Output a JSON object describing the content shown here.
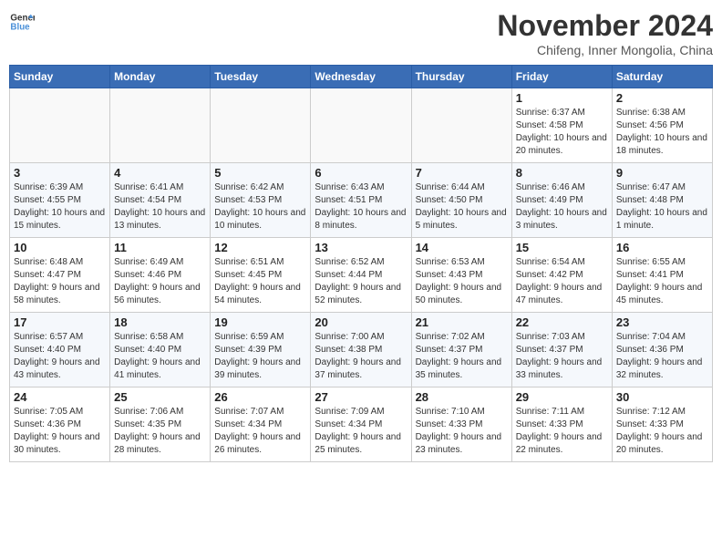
{
  "logo": {
    "line1": "General",
    "line2": "Blue"
  },
  "title": "November 2024",
  "location": "Chifeng, Inner Mongolia, China",
  "days_of_week": [
    "Sunday",
    "Monday",
    "Tuesday",
    "Wednesday",
    "Thursday",
    "Friday",
    "Saturday"
  ],
  "weeks": [
    [
      {
        "num": "",
        "info": ""
      },
      {
        "num": "",
        "info": ""
      },
      {
        "num": "",
        "info": ""
      },
      {
        "num": "",
        "info": ""
      },
      {
        "num": "",
        "info": ""
      },
      {
        "num": "1",
        "info": "Sunrise: 6:37 AM\nSunset: 4:58 PM\nDaylight: 10 hours and 20 minutes."
      },
      {
        "num": "2",
        "info": "Sunrise: 6:38 AM\nSunset: 4:56 PM\nDaylight: 10 hours and 18 minutes."
      }
    ],
    [
      {
        "num": "3",
        "info": "Sunrise: 6:39 AM\nSunset: 4:55 PM\nDaylight: 10 hours and 15 minutes."
      },
      {
        "num": "4",
        "info": "Sunrise: 6:41 AM\nSunset: 4:54 PM\nDaylight: 10 hours and 13 minutes."
      },
      {
        "num": "5",
        "info": "Sunrise: 6:42 AM\nSunset: 4:53 PM\nDaylight: 10 hours and 10 minutes."
      },
      {
        "num": "6",
        "info": "Sunrise: 6:43 AM\nSunset: 4:51 PM\nDaylight: 10 hours and 8 minutes."
      },
      {
        "num": "7",
        "info": "Sunrise: 6:44 AM\nSunset: 4:50 PM\nDaylight: 10 hours and 5 minutes."
      },
      {
        "num": "8",
        "info": "Sunrise: 6:46 AM\nSunset: 4:49 PM\nDaylight: 10 hours and 3 minutes."
      },
      {
        "num": "9",
        "info": "Sunrise: 6:47 AM\nSunset: 4:48 PM\nDaylight: 10 hours and 1 minute."
      }
    ],
    [
      {
        "num": "10",
        "info": "Sunrise: 6:48 AM\nSunset: 4:47 PM\nDaylight: 9 hours and 58 minutes."
      },
      {
        "num": "11",
        "info": "Sunrise: 6:49 AM\nSunset: 4:46 PM\nDaylight: 9 hours and 56 minutes."
      },
      {
        "num": "12",
        "info": "Sunrise: 6:51 AM\nSunset: 4:45 PM\nDaylight: 9 hours and 54 minutes."
      },
      {
        "num": "13",
        "info": "Sunrise: 6:52 AM\nSunset: 4:44 PM\nDaylight: 9 hours and 52 minutes."
      },
      {
        "num": "14",
        "info": "Sunrise: 6:53 AM\nSunset: 4:43 PM\nDaylight: 9 hours and 50 minutes."
      },
      {
        "num": "15",
        "info": "Sunrise: 6:54 AM\nSunset: 4:42 PM\nDaylight: 9 hours and 47 minutes."
      },
      {
        "num": "16",
        "info": "Sunrise: 6:55 AM\nSunset: 4:41 PM\nDaylight: 9 hours and 45 minutes."
      }
    ],
    [
      {
        "num": "17",
        "info": "Sunrise: 6:57 AM\nSunset: 4:40 PM\nDaylight: 9 hours and 43 minutes."
      },
      {
        "num": "18",
        "info": "Sunrise: 6:58 AM\nSunset: 4:40 PM\nDaylight: 9 hours and 41 minutes."
      },
      {
        "num": "19",
        "info": "Sunrise: 6:59 AM\nSunset: 4:39 PM\nDaylight: 9 hours and 39 minutes."
      },
      {
        "num": "20",
        "info": "Sunrise: 7:00 AM\nSunset: 4:38 PM\nDaylight: 9 hours and 37 minutes."
      },
      {
        "num": "21",
        "info": "Sunrise: 7:02 AM\nSunset: 4:37 PM\nDaylight: 9 hours and 35 minutes."
      },
      {
        "num": "22",
        "info": "Sunrise: 7:03 AM\nSunset: 4:37 PM\nDaylight: 9 hours and 33 minutes."
      },
      {
        "num": "23",
        "info": "Sunrise: 7:04 AM\nSunset: 4:36 PM\nDaylight: 9 hours and 32 minutes."
      }
    ],
    [
      {
        "num": "24",
        "info": "Sunrise: 7:05 AM\nSunset: 4:36 PM\nDaylight: 9 hours and 30 minutes."
      },
      {
        "num": "25",
        "info": "Sunrise: 7:06 AM\nSunset: 4:35 PM\nDaylight: 9 hours and 28 minutes."
      },
      {
        "num": "26",
        "info": "Sunrise: 7:07 AM\nSunset: 4:34 PM\nDaylight: 9 hours and 26 minutes."
      },
      {
        "num": "27",
        "info": "Sunrise: 7:09 AM\nSunset: 4:34 PM\nDaylight: 9 hours and 25 minutes."
      },
      {
        "num": "28",
        "info": "Sunrise: 7:10 AM\nSunset: 4:33 PM\nDaylight: 9 hours and 23 minutes."
      },
      {
        "num": "29",
        "info": "Sunrise: 7:11 AM\nSunset: 4:33 PM\nDaylight: 9 hours and 22 minutes."
      },
      {
        "num": "30",
        "info": "Sunrise: 7:12 AM\nSunset: 4:33 PM\nDaylight: 9 hours and 20 minutes."
      }
    ]
  ]
}
